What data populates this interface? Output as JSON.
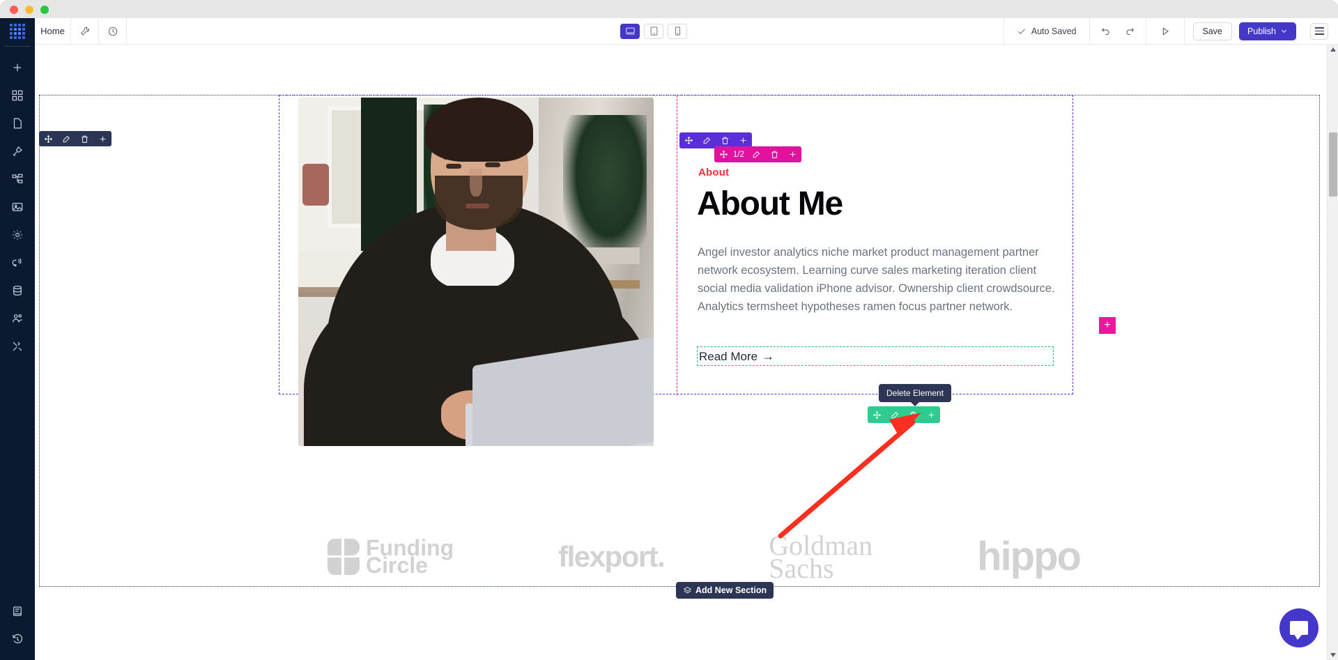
{
  "window": {
    "traffic_lights": [
      "close",
      "minimize",
      "maximize"
    ]
  },
  "topbar": {
    "tab_label": "Home",
    "wrench_icon": "wrench-icon",
    "clock_icon": "clock-icon",
    "devices": [
      {
        "name": "desktop",
        "icon": "desktop-icon",
        "active": true
      },
      {
        "name": "tablet",
        "icon": "tablet-icon",
        "active": false
      },
      {
        "name": "mobile",
        "icon": "mobile-icon",
        "active": false
      }
    ],
    "autosaved_label": "Auto Saved",
    "undo_icon": "undo-icon",
    "redo_icon": "redo-icon",
    "preview_icon": "play-preview-icon",
    "save_label": "Save",
    "publish_label": "Publish",
    "menu_icon": "hamburger-menu-icon"
  },
  "sidebar": {
    "logo": "grid-logo",
    "items": [
      {
        "name": "add",
        "icon": "plus-icon"
      },
      {
        "name": "widgets",
        "icon": "widgets-grid-icon"
      },
      {
        "name": "pages",
        "icon": "page-icon"
      },
      {
        "name": "styles",
        "icon": "brush-icon"
      },
      {
        "name": "layers",
        "icon": "sitemap-icon"
      },
      {
        "name": "media",
        "icon": "image-icon"
      },
      {
        "name": "settings",
        "icon": "gear-icon"
      },
      {
        "name": "integrations",
        "icon": "broadcast-icon"
      },
      {
        "name": "database",
        "icon": "database-icon"
      },
      {
        "name": "users",
        "icon": "users-icon"
      },
      {
        "name": "tools",
        "icon": "tools-icon"
      }
    ],
    "bottom_items": [
      {
        "name": "docs",
        "icon": "book-icon"
      },
      {
        "name": "history",
        "icon": "history-revert-icon"
      }
    ]
  },
  "canvas": {
    "section": {
      "eyebrow": "About",
      "heading": "About Me",
      "body": "Angel investor analytics niche market product management partner network ecosystem. Learning curve sales marketing iteration client social media validation iPhone advisor. Ownership client crowdsource. Analytics termsheet hypotheses ramen focus partner network.",
      "cta_label": "Read More",
      "cta_arrow": "→",
      "image_alt": "man-in-dark-hoodie-working-on-laptop"
    },
    "logos": [
      {
        "name": "funding-circle",
        "line1": "Funding",
        "line2": "Circle"
      },
      {
        "name": "flexport",
        "text": "flexport."
      },
      {
        "name": "goldman-sachs",
        "line1": "Goldman",
        "line2": "Sachs"
      },
      {
        "name": "hippo",
        "text": "hippo"
      }
    ]
  },
  "overlays": {
    "section_toolbar": {
      "color": "#2c3654",
      "actions": [
        "move-icon",
        "edit-icon",
        "trash-icon",
        "plus-icon"
      ]
    },
    "row_toolbar": {
      "color": "#5b2fd6",
      "actions": [
        "move-icon",
        "edit-icon",
        "trash-icon",
        "plus-icon"
      ]
    },
    "column_toolbar": {
      "color": "#e1129e",
      "label": "1/2",
      "actions": [
        "move-icon",
        "edit-icon",
        "trash-icon",
        "plus-icon"
      ]
    },
    "element_toolbar": {
      "color": "#2ecc8f",
      "actions": [
        "move-icon",
        "edit-icon",
        "trash-icon",
        "plus-icon"
      ],
      "globe_action": "globe-icon"
    },
    "tooltip_delete": "Delete Element",
    "add_section_label": "Add New Section",
    "add_column_plus": "+"
  },
  "chat": {
    "icon": "chat-bubble-icon"
  },
  "colors": {
    "brand_purple": "#4338ca",
    "accent_red": "#ff2b3e",
    "row_purple": "#5b2fd6",
    "column_magenta": "#e1129e",
    "element_green": "#2ecc8f",
    "section_navy": "#2c3654",
    "rail_navy": "#0b1a31"
  }
}
